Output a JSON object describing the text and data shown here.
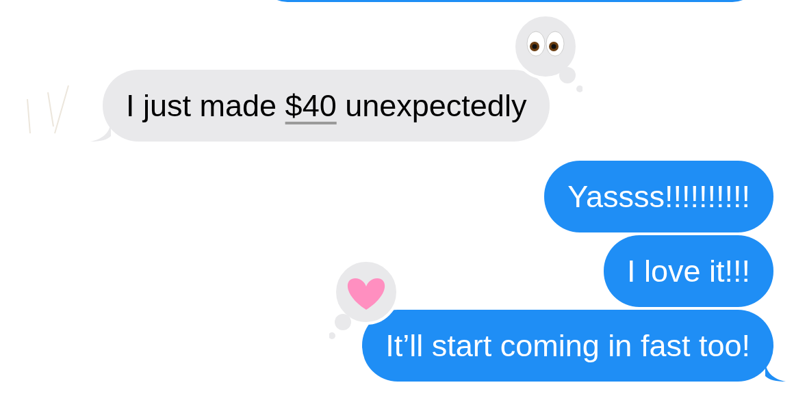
{
  "messages": [
    {
      "kind": "incoming",
      "parts": [
        {
          "text": "I just made "
        },
        {
          "text": "$40",
          "kind": "link"
        },
        {
          "text": " unexpectedly"
        }
      ],
      "tail": true,
      "reaction": {
        "kind": "eyes"
      }
    },
    {
      "kind": "outgoing",
      "parts": [
        {
          "text": "Yassss!!!!!!!!!!"
        }
      ],
      "tail": false
    },
    {
      "kind": "outgoing",
      "parts": [
        {
          "text": "I love it!!!"
        }
      ],
      "tail": false
    },
    {
      "kind": "outgoing",
      "parts": [
        {
          "text": "It’ll start coming in fast too!"
        }
      ],
      "tail": true,
      "reaction": {
        "kind": "heart"
      }
    }
  ]
}
